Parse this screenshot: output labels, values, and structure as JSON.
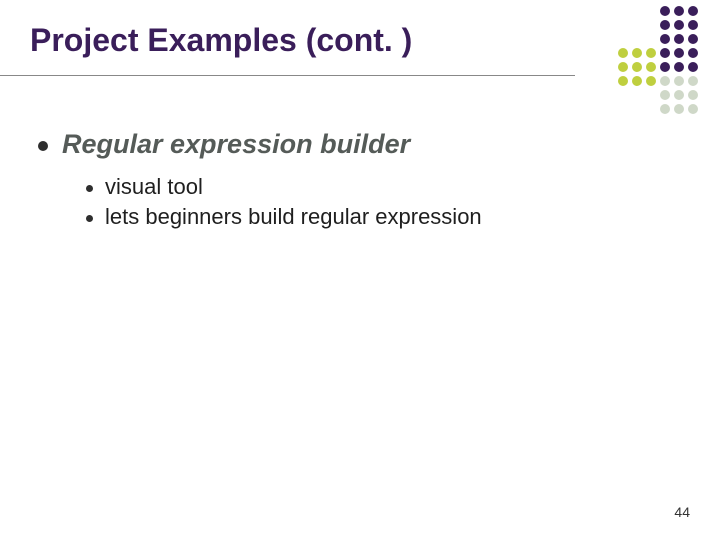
{
  "title": "Project Examples (cont. )",
  "content": {
    "heading": "Regular expression builder",
    "items": [
      "visual tool",
      "lets beginners build regular expression"
    ]
  },
  "page_number": "44",
  "decoration": {
    "colors": {
      "purple": "#3a1e5a",
      "olive": "#bfcf3f",
      "gray": "#cfd8c8"
    }
  }
}
